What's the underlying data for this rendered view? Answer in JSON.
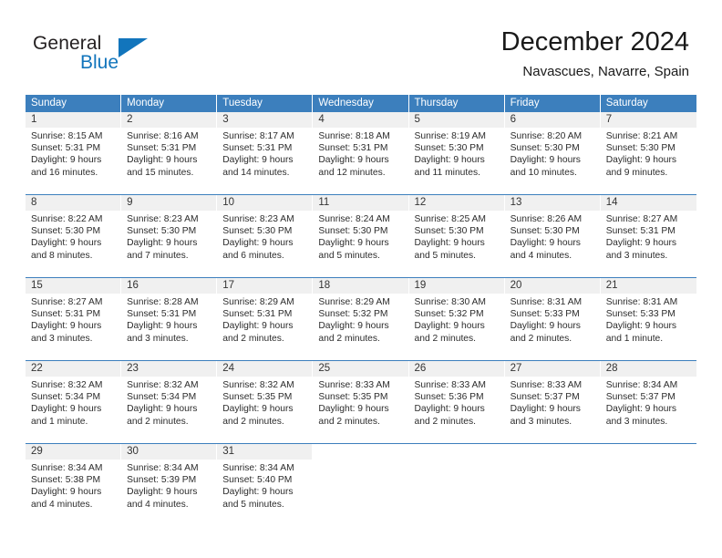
{
  "brand": {
    "name_part1": "General",
    "name_part2": "Blue",
    "triangle_icon": "triangle-icon",
    "accent_color": "#1275bc"
  },
  "header": {
    "title": "December 2024",
    "location": "Navascues, Navarre, Spain"
  },
  "theme": {
    "header_row_bg": "#3c7fbd",
    "day_number_bg": "#f0f0f0",
    "row_divider": "#3c7fbd",
    "text": "#2c2c2c"
  },
  "weekdays": [
    "Sunday",
    "Monday",
    "Tuesday",
    "Wednesday",
    "Thursday",
    "Friday",
    "Saturday"
  ],
  "weeks": [
    [
      {
        "day": "1",
        "sunrise": "Sunrise: 8:15 AM",
        "sunset": "Sunset: 5:31 PM",
        "daylight1": "Daylight: 9 hours",
        "daylight2": "and 16 minutes."
      },
      {
        "day": "2",
        "sunrise": "Sunrise: 8:16 AM",
        "sunset": "Sunset: 5:31 PM",
        "daylight1": "Daylight: 9 hours",
        "daylight2": "and 15 minutes."
      },
      {
        "day": "3",
        "sunrise": "Sunrise: 8:17 AM",
        "sunset": "Sunset: 5:31 PM",
        "daylight1": "Daylight: 9 hours",
        "daylight2": "and 14 minutes."
      },
      {
        "day": "4",
        "sunrise": "Sunrise: 8:18 AM",
        "sunset": "Sunset: 5:31 PM",
        "daylight1": "Daylight: 9 hours",
        "daylight2": "and 12 minutes."
      },
      {
        "day": "5",
        "sunrise": "Sunrise: 8:19 AM",
        "sunset": "Sunset: 5:30 PM",
        "daylight1": "Daylight: 9 hours",
        "daylight2": "and 11 minutes."
      },
      {
        "day": "6",
        "sunrise": "Sunrise: 8:20 AM",
        "sunset": "Sunset: 5:30 PM",
        "daylight1": "Daylight: 9 hours",
        "daylight2": "and 10 minutes."
      },
      {
        "day": "7",
        "sunrise": "Sunrise: 8:21 AM",
        "sunset": "Sunset: 5:30 PM",
        "daylight1": "Daylight: 9 hours",
        "daylight2": "and 9 minutes."
      }
    ],
    [
      {
        "day": "8",
        "sunrise": "Sunrise: 8:22 AM",
        "sunset": "Sunset: 5:30 PM",
        "daylight1": "Daylight: 9 hours",
        "daylight2": "and 8 minutes."
      },
      {
        "day": "9",
        "sunrise": "Sunrise: 8:23 AM",
        "sunset": "Sunset: 5:30 PM",
        "daylight1": "Daylight: 9 hours",
        "daylight2": "and 7 minutes."
      },
      {
        "day": "10",
        "sunrise": "Sunrise: 8:23 AM",
        "sunset": "Sunset: 5:30 PM",
        "daylight1": "Daylight: 9 hours",
        "daylight2": "and 6 minutes."
      },
      {
        "day": "11",
        "sunrise": "Sunrise: 8:24 AM",
        "sunset": "Sunset: 5:30 PM",
        "daylight1": "Daylight: 9 hours",
        "daylight2": "and 5 minutes."
      },
      {
        "day": "12",
        "sunrise": "Sunrise: 8:25 AM",
        "sunset": "Sunset: 5:30 PM",
        "daylight1": "Daylight: 9 hours",
        "daylight2": "and 5 minutes."
      },
      {
        "day": "13",
        "sunrise": "Sunrise: 8:26 AM",
        "sunset": "Sunset: 5:30 PM",
        "daylight1": "Daylight: 9 hours",
        "daylight2": "and 4 minutes."
      },
      {
        "day": "14",
        "sunrise": "Sunrise: 8:27 AM",
        "sunset": "Sunset: 5:31 PM",
        "daylight1": "Daylight: 9 hours",
        "daylight2": "and 3 minutes."
      }
    ],
    [
      {
        "day": "15",
        "sunrise": "Sunrise: 8:27 AM",
        "sunset": "Sunset: 5:31 PM",
        "daylight1": "Daylight: 9 hours",
        "daylight2": "and 3 minutes."
      },
      {
        "day": "16",
        "sunrise": "Sunrise: 8:28 AM",
        "sunset": "Sunset: 5:31 PM",
        "daylight1": "Daylight: 9 hours",
        "daylight2": "and 3 minutes."
      },
      {
        "day": "17",
        "sunrise": "Sunrise: 8:29 AM",
        "sunset": "Sunset: 5:31 PM",
        "daylight1": "Daylight: 9 hours",
        "daylight2": "and 2 minutes."
      },
      {
        "day": "18",
        "sunrise": "Sunrise: 8:29 AM",
        "sunset": "Sunset: 5:32 PM",
        "daylight1": "Daylight: 9 hours",
        "daylight2": "and 2 minutes."
      },
      {
        "day": "19",
        "sunrise": "Sunrise: 8:30 AM",
        "sunset": "Sunset: 5:32 PM",
        "daylight1": "Daylight: 9 hours",
        "daylight2": "and 2 minutes."
      },
      {
        "day": "20",
        "sunrise": "Sunrise: 8:31 AM",
        "sunset": "Sunset: 5:33 PM",
        "daylight1": "Daylight: 9 hours",
        "daylight2": "and 2 minutes."
      },
      {
        "day": "21",
        "sunrise": "Sunrise: 8:31 AM",
        "sunset": "Sunset: 5:33 PM",
        "daylight1": "Daylight: 9 hours",
        "daylight2": "and 1 minute."
      }
    ],
    [
      {
        "day": "22",
        "sunrise": "Sunrise: 8:32 AM",
        "sunset": "Sunset: 5:34 PM",
        "daylight1": "Daylight: 9 hours",
        "daylight2": "and 1 minute."
      },
      {
        "day": "23",
        "sunrise": "Sunrise: 8:32 AM",
        "sunset": "Sunset: 5:34 PM",
        "daylight1": "Daylight: 9 hours",
        "daylight2": "and 2 minutes."
      },
      {
        "day": "24",
        "sunrise": "Sunrise: 8:32 AM",
        "sunset": "Sunset: 5:35 PM",
        "daylight1": "Daylight: 9 hours",
        "daylight2": "and 2 minutes."
      },
      {
        "day": "25",
        "sunrise": "Sunrise: 8:33 AM",
        "sunset": "Sunset: 5:35 PM",
        "daylight1": "Daylight: 9 hours",
        "daylight2": "and 2 minutes."
      },
      {
        "day": "26",
        "sunrise": "Sunrise: 8:33 AM",
        "sunset": "Sunset: 5:36 PM",
        "daylight1": "Daylight: 9 hours",
        "daylight2": "and 2 minutes."
      },
      {
        "day": "27",
        "sunrise": "Sunrise: 8:33 AM",
        "sunset": "Sunset: 5:37 PM",
        "daylight1": "Daylight: 9 hours",
        "daylight2": "and 3 minutes."
      },
      {
        "day": "28",
        "sunrise": "Sunrise: 8:34 AM",
        "sunset": "Sunset: 5:37 PM",
        "daylight1": "Daylight: 9 hours",
        "daylight2": "and 3 minutes."
      }
    ],
    [
      {
        "day": "29",
        "sunrise": "Sunrise: 8:34 AM",
        "sunset": "Sunset: 5:38 PM",
        "daylight1": "Daylight: 9 hours",
        "daylight2": "and 4 minutes."
      },
      {
        "day": "30",
        "sunrise": "Sunrise: 8:34 AM",
        "sunset": "Sunset: 5:39 PM",
        "daylight1": "Daylight: 9 hours",
        "daylight2": "and 4 minutes."
      },
      {
        "day": "31",
        "sunrise": "Sunrise: 8:34 AM",
        "sunset": "Sunset: 5:40 PM",
        "daylight1": "Daylight: 9 hours",
        "daylight2": "and 5 minutes."
      },
      {
        "day": "",
        "sunrise": "",
        "sunset": "",
        "daylight1": "",
        "daylight2": ""
      },
      {
        "day": "",
        "sunrise": "",
        "sunset": "",
        "daylight1": "",
        "daylight2": ""
      },
      {
        "day": "",
        "sunrise": "",
        "sunset": "",
        "daylight1": "",
        "daylight2": ""
      },
      {
        "day": "",
        "sunrise": "",
        "sunset": "",
        "daylight1": "",
        "daylight2": ""
      }
    ]
  ]
}
